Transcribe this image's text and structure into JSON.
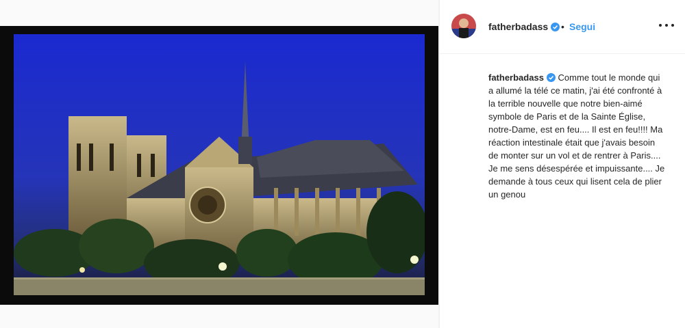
{
  "post": {
    "username": "fatherbadass",
    "follow_label": "Segui",
    "separator": "•",
    "caption_username": "fatherbadass",
    "caption_text": "Comme tout le monde qui a allumé la télé ce matin, j'ai été confronté à la terrible nouvelle que notre bien-aimé symbole de Paris et de la Sainte Église, notre-Dame, est en feu.... Il est en feu!!!! Ma réaction intestinale était que j'avais besoin de monter sur un vol et de rentrer à Paris.... Je me sens désespérée et impuissante.... Je demande à tous ceux qui lisent cela de plier un genou"
  },
  "icons": {
    "verified": "verified-badge-icon",
    "more": "more-options-icon"
  },
  "colors": {
    "link_blue": "#3897f0",
    "verified_blue": "#3897f0",
    "sky": "#1d2fc4",
    "text": "#262626"
  }
}
